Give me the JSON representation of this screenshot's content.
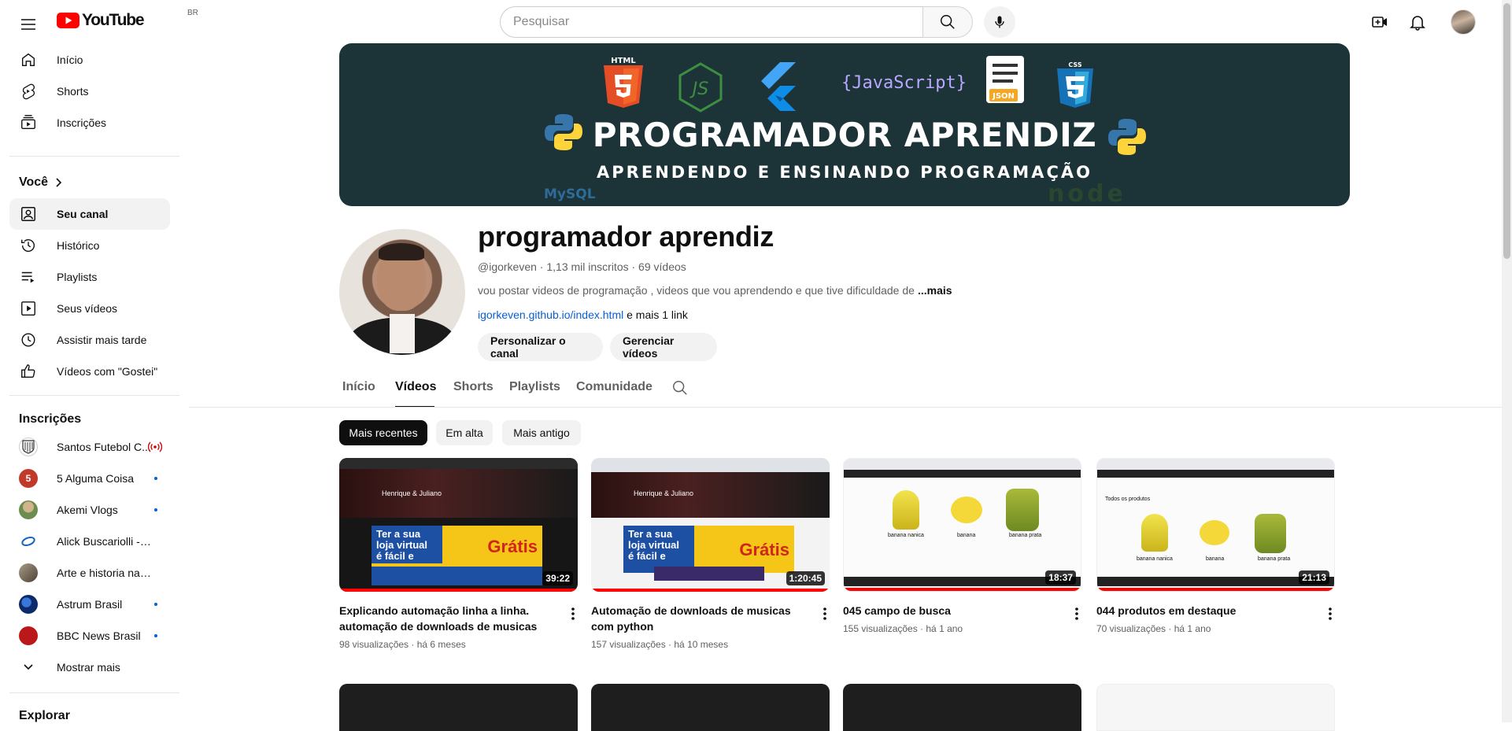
{
  "header": {
    "logo_text": "YouTube",
    "country_code": "BR",
    "search_placeholder": "Pesquisar"
  },
  "sidebar": {
    "main": [
      {
        "label": "Início",
        "icon": "home-icon"
      },
      {
        "label": "Shorts",
        "icon": "shorts-icon"
      },
      {
        "label": "Inscrições",
        "icon": "subscriptions-icon"
      }
    ],
    "you_heading": "Você",
    "you": [
      {
        "label": "Seu canal",
        "icon": "your-channel-icon",
        "active": true
      },
      {
        "label": "Histórico",
        "icon": "history-icon"
      },
      {
        "label": "Playlists",
        "icon": "playlists-icon"
      },
      {
        "label": "Seus vídeos",
        "icon": "your-videos-icon"
      },
      {
        "label": "Assistir mais tarde",
        "icon": "watch-later-icon"
      },
      {
        "label": "Vídeos com \"Gostei\"",
        "icon": "liked-icon"
      }
    ],
    "subscriptions_heading": "Inscrições",
    "subscriptions": [
      {
        "label": "Santos Futebol C...",
        "color": "#333333",
        "status": "live"
      },
      {
        "label": "5 Alguma Coisa",
        "color": "#c0392b",
        "status": "new"
      },
      {
        "label": "Akemi Vlogs",
        "color": "#8a7a5a",
        "status": "new"
      },
      {
        "label": "Alick Buscariolli - Fl...",
        "color": "#1565c0",
        "status": "none"
      },
      {
        "label": "Arte e historia na It...",
        "color": "#7a6a5a",
        "status": "none"
      },
      {
        "label": "Astrum Brasil",
        "color": "#0d2a6b",
        "status": "new"
      },
      {
        "label": "BBC News Brasil",
        "color": "#bb1919",
        "status": "new"
      }
    ],
    "show_more": "Mostrar mais",
    "explore_heading": "Explorar"
  },
  "banner": {
    "title": "PROGRAMADOR APRENDIZ",
    "subtitle": "APRENDENDO E ENSINANDO PROGRAMAÇÃO",
    "badges": [
      "HTML",
      "CSS",
      "{JavaScript}",
      "JSON",
      "MySQL",
      "node"
    ]
  },
  "channel": {
    "name": "programador aprendiz",
    "meta": "@igorkeven · 1,13 mil inscritos · 69 vídeos",
    "description": "vou postar videos de programação , videos que vou aprendendo e que tive dificuldade de",
    "more": "...mais",
    "link": "igorkeven.github.io/index.html",
    "link_more": " e mais 1 link",
    "buttons": [
      "Personalizar o canal",
      "Gerenciar vídeos"
    ]
  },
  "tabs": [
    "Início",
    "Vídeos",
    "Shorts",
    "Playlists",
    "Comunidade"
  ],
  "active_tab": "Vídeos",
  "chips": [
    "Mais recentes",
    "Em alta",
    "Mais antigo"
  ],
  "videos": [
    {
      "title": "Explicando automação linha a linha. automação de downloads de musicas com...",
      "meta": "98 visualizações · há 6 meses",
      "duration": "39:22",
      "theme": "store"
    },
    {
      "title": "Automação de downloads de musicas com python",
      "meta": "157 visualizações · há 10 meses",
      "duration": "1:20:45",
      "theme": "store"
    },
    {
      "title": "045 campo de busca",
      "meta": "155 visualizações · há 1 ano",
      "duration": "18:37",
      "theme": "bananas"
    },
    {
      "title": "044 produtos em destaque",
      "meta": "70 visualizações · há 1 ano",
      "duration": "21:13",
      "theme": "bananas"
    }
  ],
  "thumb_text": {
    "store_heading": "Henrique & Juliano",
    "store_line1": "Ter a sua",
    "store_line2": "loja virtual",
    "store_line3": "é fácil e",
    "store_promo": "Grátis",
    "banana_labels": [
      "banana nanica",
      "banana",
      "banana prata"
    ],
    "products_heading": "Todos os produtos"
  }
}
